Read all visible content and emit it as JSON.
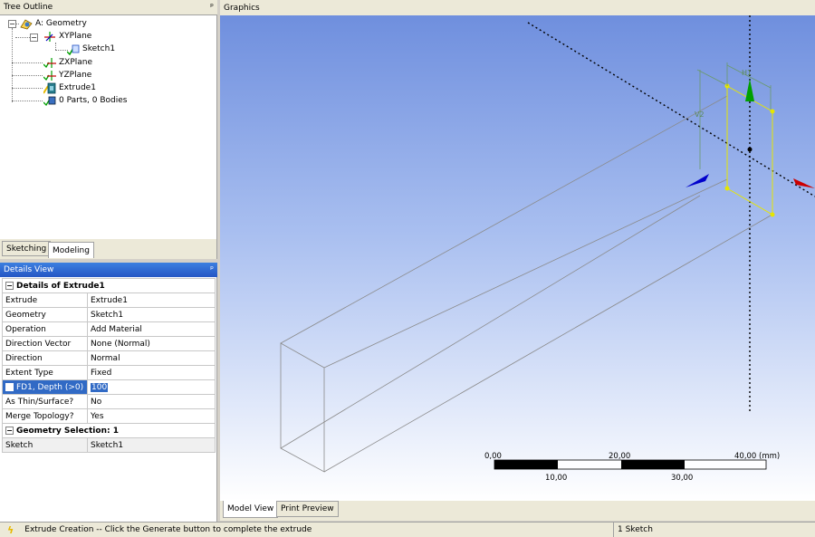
{
  "tree": {
    "header": "Tree Outline",
    "pin": "ᵩ",
    "items": [
      {
        "label": "A: Geometry"
      },
      {
        "label": "XYPlane"
      },
      {
        "label": "Sketch1"
      },
      {
        "label": "ZXPlane"
      },
      {
        "label": "YZPlane"
      },
      {
        "label": "Extrude1"
      },
      {
        "label": "0 Parts, 0 Bodies"
      }
    ],
    "tabs": [
      "Sketching",
      "Modeling"
    ],
    "active_tab": "Modeling"
  },
  "details": {
    "header": "Details View",
    "pin": "ᵩ",
    "group1": "Details of Extrude1",
    "rows": [
      {
        "label": "Extrude",
        "value": "Extrude1"
      },
      {
        "label": "Geometry",
        "value": "Sketch1"
      },
      {
        "label": "Operation",
        "value": "Add Material"
      },
      {
        "label": "Direction Vector",
        "value": "None (Normal)"
      },
      {
        "label": "Direction",
        "value": "Normal"
      },
      {
        "label": "Extent Type",
        "value": "Fixed"
      },
      {
        "label": "FD1,  Depth (>0)",
        "value": "100"
      },
      {
        "label": "As Thin/Surface?",
        "value": "No"
      },
      {
        "label": "Merge Topology?",
        "value": "Yes"
      }
    ],
    "group2": "Geometry Selection: 1",
    "sel_rows": [
      {
        "label": "Sketch",
        "value": "Sketch1"
      }
    ]
  },
  "graphics": {
    "header": "Graphics",
    "scale": {
      "top_labels": [
        "0,00",
        "20,00",
        "40,00 (mm)"
      ],
      "bottom_labels": [
        "10,00",
        "30,00"
      ]
    },
    "sketch_dims": {
      "h": "H1",
      "v": "V2"
    },
    "tabs": [
      "Model View",
      "Print Preview"
    ],
    "active_tab": "Model View"
  },
  "status": {
    "message": "Extrude Creation -- Click the Generate button to complete the extrude",
    "right": "1 Sketch"
  },
  "colors": {
    "selection": "#316ac5",
    "sketch": "#ffff00",
    "axis_x": "#cc0000",
    "axis_y": "#00aa00",
    "axis_z": "#0000cc"
  }
}
